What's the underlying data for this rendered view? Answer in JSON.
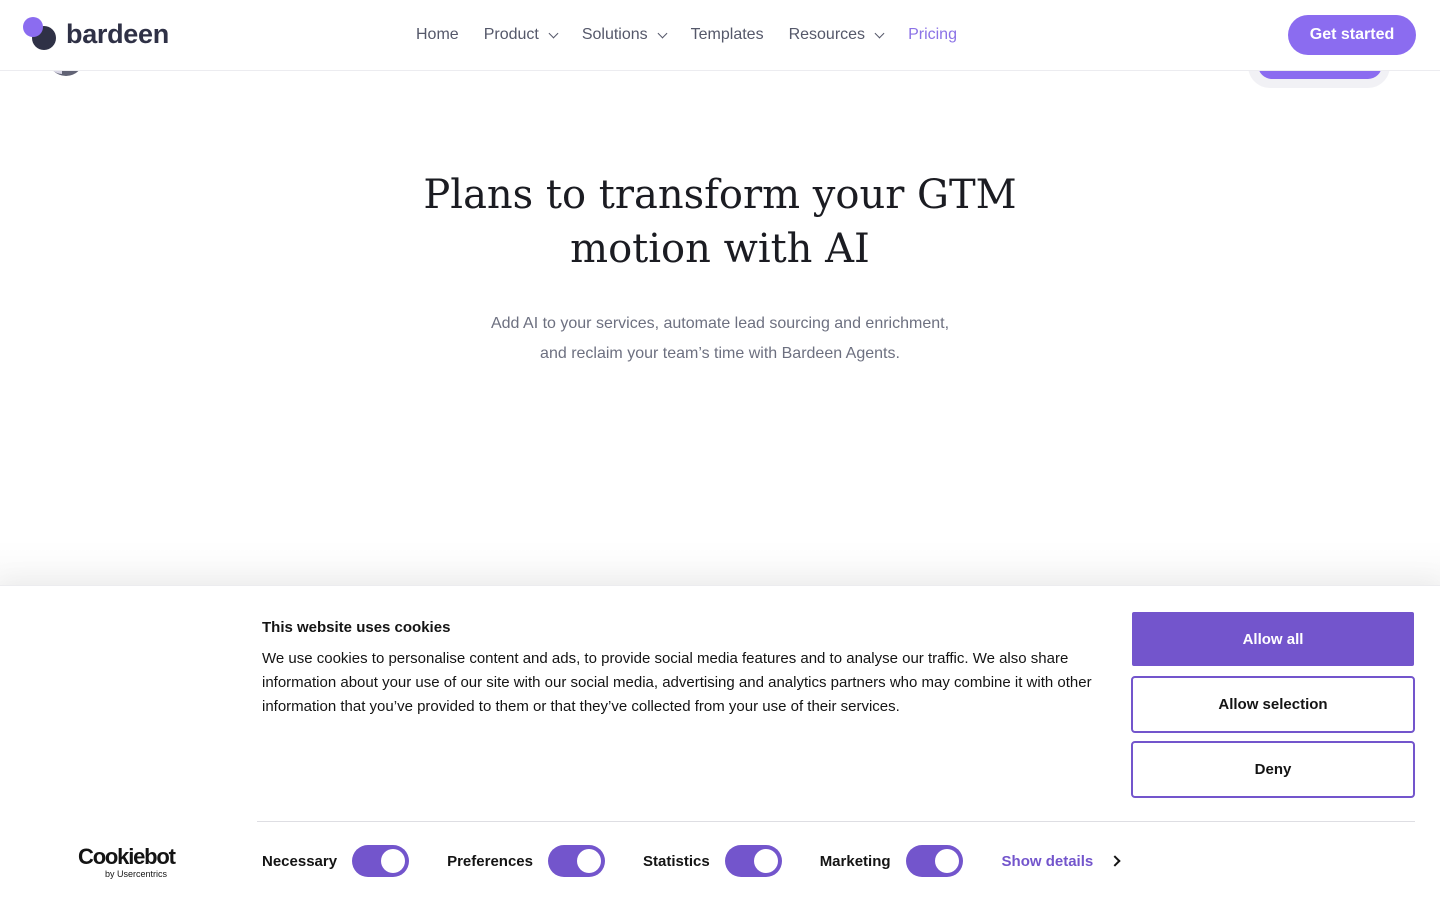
{
  "brand": {
    "name": "bardeen"
  },
  "nav": {
    "items": [
      {
        "label": "Home"
      },
      {
        "label": "Product"
      },
      {
        "label": "Solutions"
      },
      {
        "label": "Templates"
      },
      {
        "label": "Resources"
      },
      {
        "label": "Pricing"
      }
    ],
    "cta_label": "Get started",
    "accent_color": "#8b6cf0"
  },
  "hero": {
    "title_line1": "Plans to transform your GTM",
    "title_line2": "motion with AI",
    "subtitle_line1": "Add AI to your services, automate lead sourcing and enrichment,",
    "subtitle_line2": "and reclaim your team’s time with Bardeen Agents."
  },
  "cookie": {
    "title": "This website uses cookies",
    "text": "We use cookies to personalise content and ads, to provide social media features and to analyse our traffic. We also share information about your use of our site with our social media, advertising and analytics partners who may combine it with other information that you’ve provided to them or that they’ve collected from your use of their services.",
    "allow_all_label": "Allow all",
    "allow_selection_label": "Allow selection",
    "deny_label": "Deny",
    "provider_logo": "Cookiebot",
    "provider_sub": "by Usercentrics",
    "toggles": [
      {
        "label": "Necessary",
        "on": true
      },
      {
        "label": "Preferences",
        "on": true
      },
      {
        "label": "Statistics",
        "on": true
      },
      {
        "label": "Marketing",
        "on": true
      }
    ],
    "show_details_label": "Show details",
    "accent_color": "#7355cc"
  }
}
